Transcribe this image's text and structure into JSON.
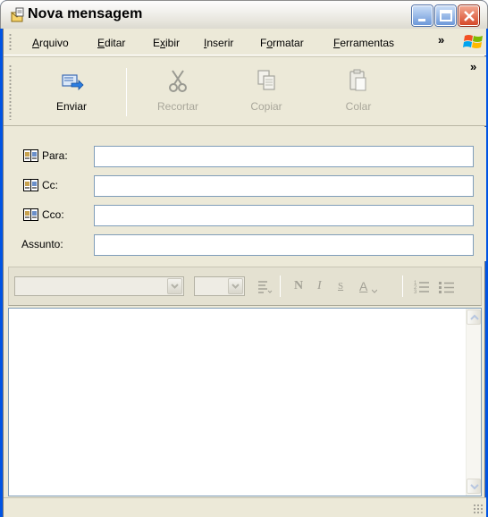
{
  "window": {
    "title": "Nova mensagem",
    "icon": "new-message-icon",
    "controls": [
      "minimize-icon",
      "maximize-icon",
      "close-icon"
    ]
  },
  "menu": {
    "items": [
      {
        "label": "Arquivo",
        "mnemonic": "A"
      },
      {
        "label": "Editar",
        "mnemonic": "E"
      },
      {
        "label": "Exibir",
        "mnemonic": "x"
      },
      {
        "label": "Inserir",
        "mnemonic": "I"
      },
      {
        "label": "Formatar",
        "mnemonic": "o"
      },
      {
        "label": "Ferramentas",
        "mnemonic": "F"
      }
    ],
    "overflow": "»"
  },
  "toolbar": {
    "buttons": [
      {
        "label": "Enviar",
        "icon": "send-icon",
        "enabled": true
      },
      {
        "label": "Recortar",
        "icon": "scissors-icon",
        "enabled": false
      },
      {
        "label": "Copiar",
        "icon": "copy-icon",
        "enabled": false
      },
      {
        "label": "Colar",
        "icon": "paste-icon",
        "enabled": false
      }
    ],
    "overflow": "»"
  },
  "fields": {
    "to_label": "Para:",
    "cc_label": "Cc:",
    "bcc_label": "Cco:",
    "subject_label": "Assunto:",
    "to_value": "",
    "cc_value": "",
    "bcc_value": "",
    "subject_value": ""
  },
  "format_bar": {
    "font_name": "",
    "font_size": "",
    "buttons": [
      "paragraph-style-icon",
      "bold-icon",
      "italic-icon",
      "underline-icon",
      "font-color-icon",
      "numbered-list-icon",
      "bulleted-list-icon"
    ],
    "bold_glyph": "N",
    "italic_glyph": "I",
    "underline_glyph": "S",
    "color_glyph": "A"
  },
  "body": {
    "text": ""
  },
  "status": {
    "text": ""
  },
  "colors": {
    "accent": "#0054e3",
    "panel": "#ece9d8",
    "input_border": "#7f9db9",
    "disabled_text": "#a9a79b"
  }
}
